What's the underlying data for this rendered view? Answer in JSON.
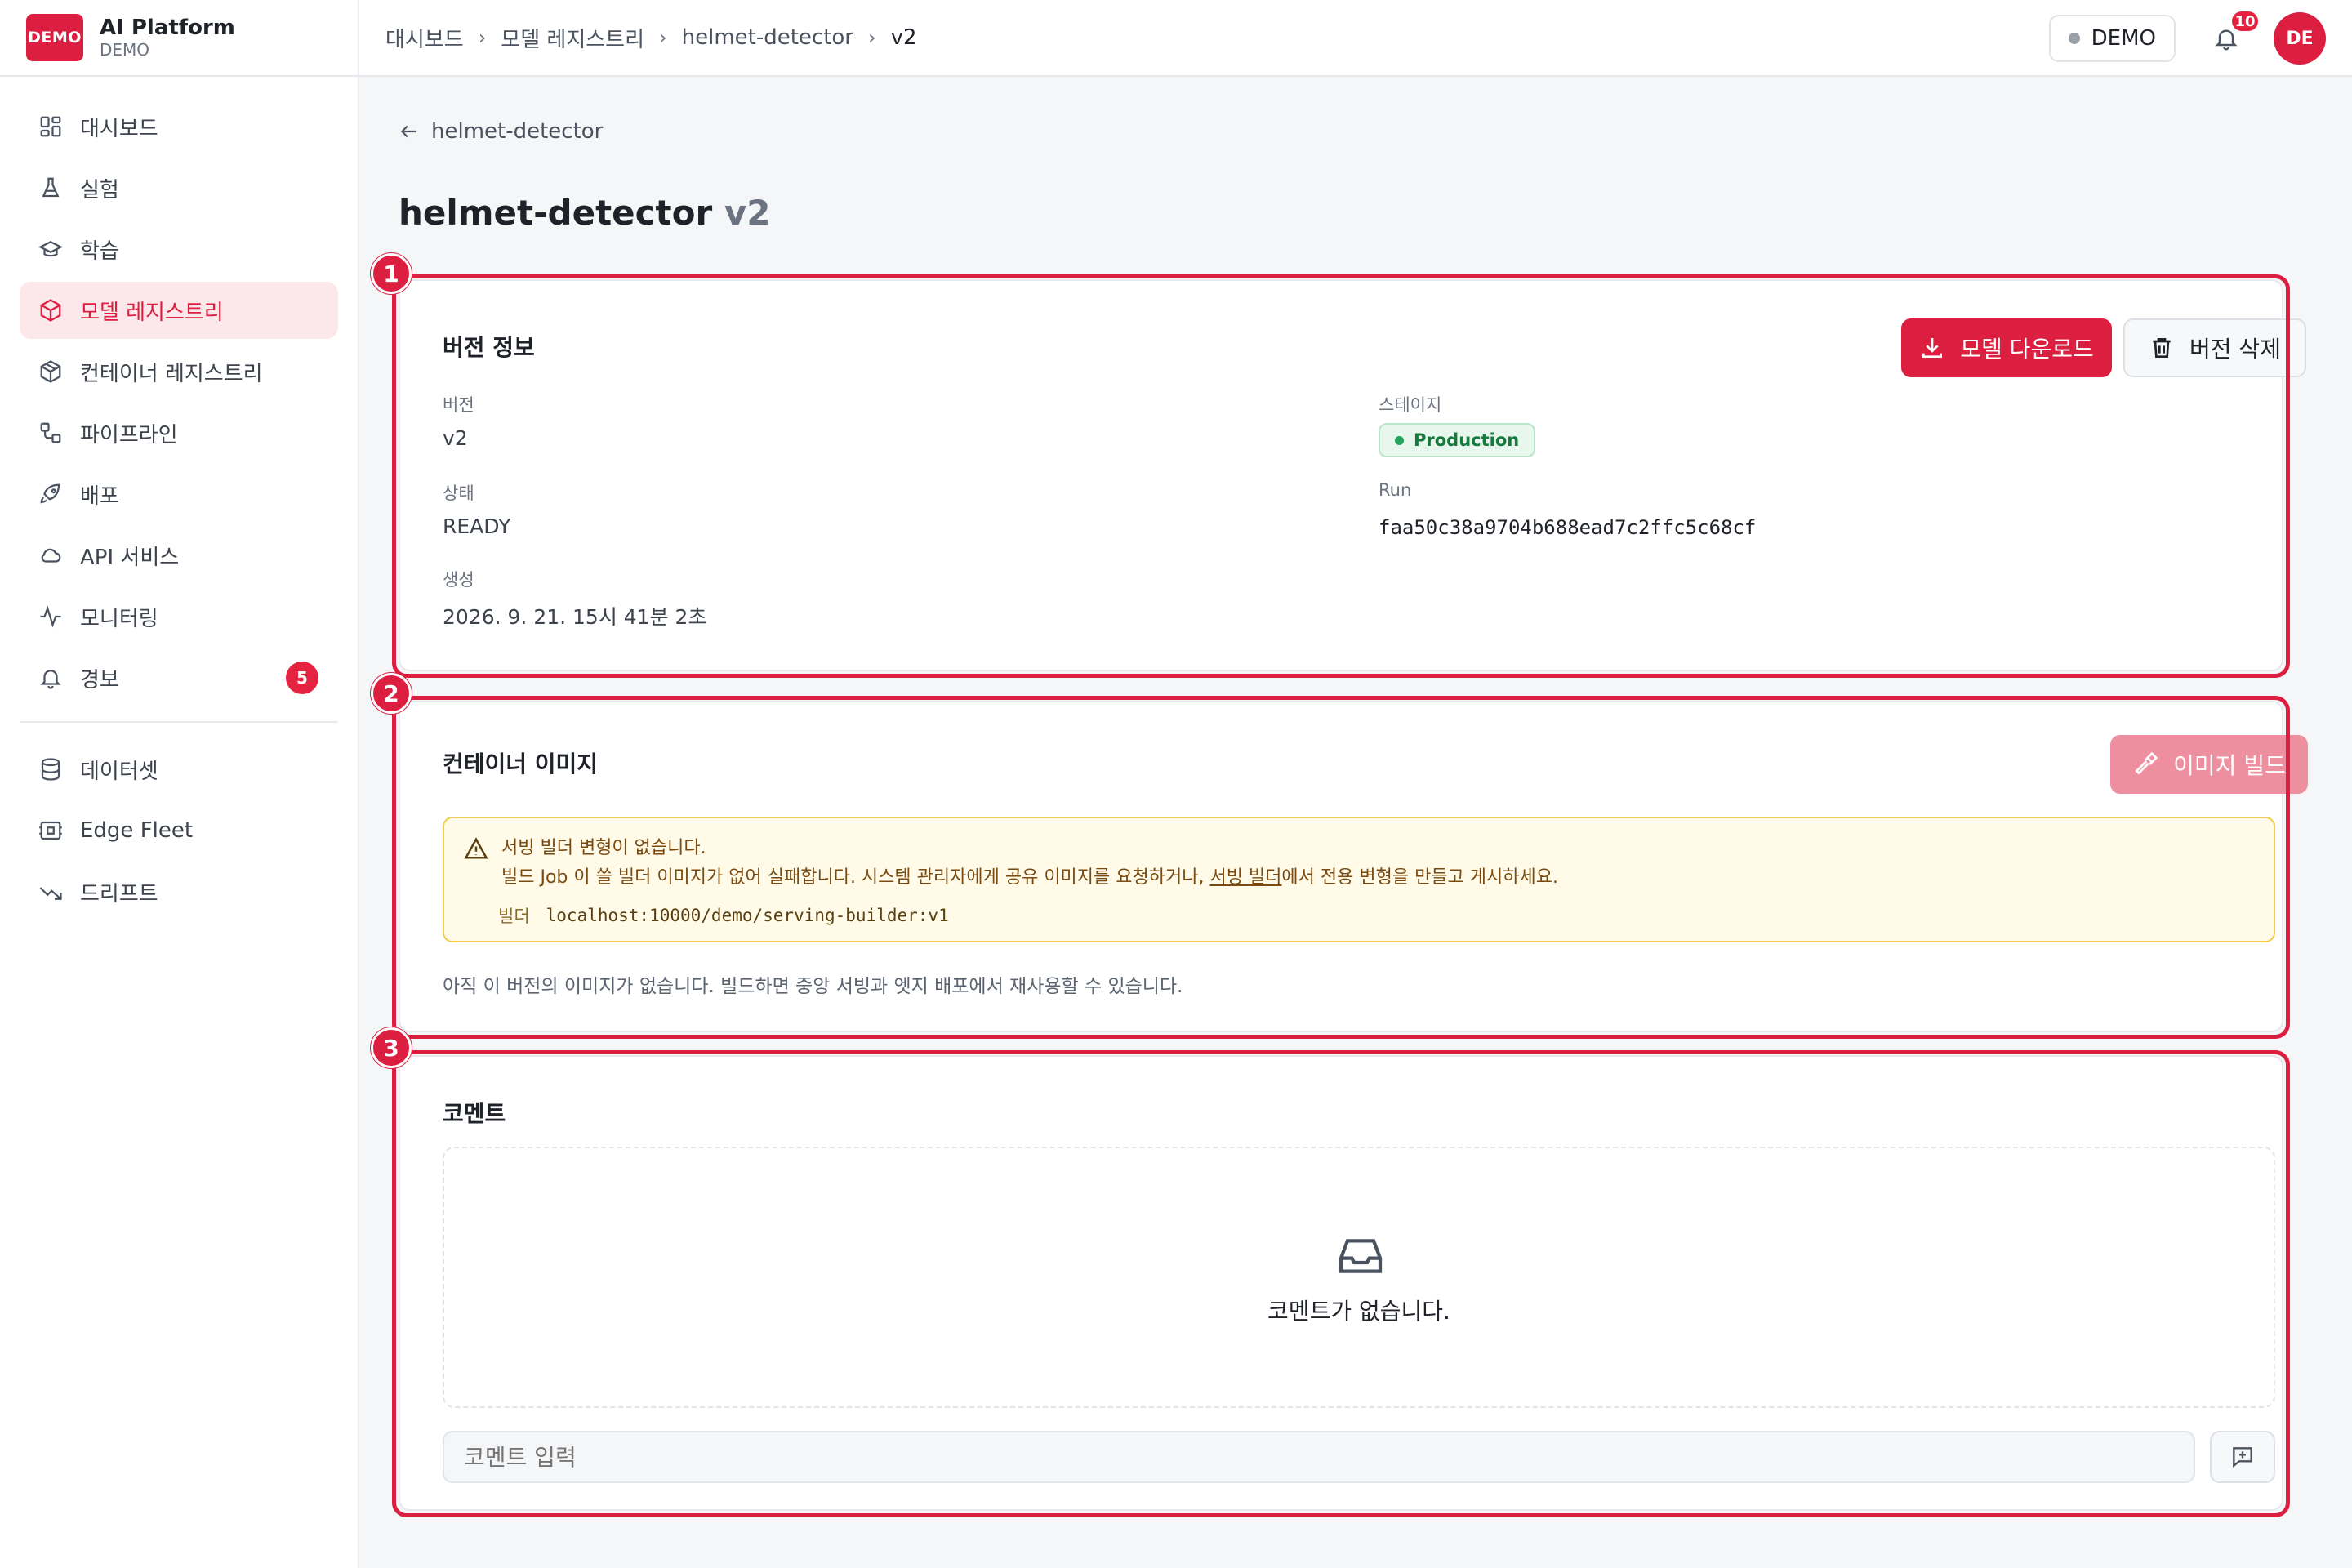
{
  "brand": {
    "logo_text": "DEMO",
    "name": "AI Platform",
    "sub": "DEMO"
  },
  "sidebar": {
    "items": [
      {
        "label": "대시보드",
        "icon": "dashboard-icon"
      },
      {
        "label": "실험",
        "icon": "flask-icon"
      },
      {
        "label": "학습",
        "icon": "graduation-cap-icon"
      },
      {
        "label": "모델 레지스트리",
        "icon": "box-icon",
        "active": true
      },
      {
        "label": "컨테이너 레지스트리",
        "icon": "package-icon"
      },
      {
        "label": "파이프라인",
        "icon": "workflow-icon"
      },
      {
        "label": "배포",
        "icon": "rocket-icon"
      },
      {
        "label": "API 서비스",
        "icon": "cloud-icon"
      },
      {
        "label": "모니터링",
        "icon": "activity-icon"
      },
      {
        "label": "경보",
        "icon": "bell-icon",
        "badge": "5"
      }
    ],
    "secondary_items": [
      {
        "label": "데이터셋",
        "icon": "database-icon"
      },
      {
        "label": "Edge Fleet",
        "icon": "cpu-icon"
      },
      {
        "label": "드리프트",
        "icon": "trending-down-icon"
      }
    ]
  },
  "breadcrumb": [
    "대시보드",
    "모델 레지스트리",
    "helmet-detector",
    "v2"
  ],
  "topbar": {
    "env": "DEMO",
    "notifications": "10",
    "avatar": "DE"
  },
  "page": {
    "back_label": "helmet-detector",
    "title": "helmet-detector",
    "title_version": "v2"
  },
  "version_info": {
    "marker": "1",
    "title": "버전 정보",
    "download_label": "모델 다운로드",
    "delete_label": "버전 삭제",
    "version_label": "버전",
    "version_value": "v2",
    "stage_label": "스테이지",
    "stage_value": "Production",
    "status_label": "상태",
    "status_value": "READY",
    "run_label": "Run",
    "run_value": "faa50c38a9704b688ead7c2ffc5c68cf",
    "created_label": "생성",
    "created_value": "2026. 9. 21. 15시 41분 2초"
  },
  "container_image": {
    "marker": "2",
    "title": "컨테이너 이미지",
    "build_label": "이미지 빌드",
    "warning_title": "서빙 빌더 변형이 없습니다.",
    "warning_body_pre": "빌드 Job 이 쓸 빌더 이미지가 없어 실패합니다. 시스템 관리자에게 공유 이미지를 요청하거나, ",
    "warning_link": "서빙 빌더",
    "warning_body_post": "에서 전용 변형을 만들고 게시하세요.",
    "builder_label": "빌더",
    "builder_value": "localhost:10000/demo/serving-builder:v1",
    "empty_note": "아직 이 버전의 이미지가 없습니다. 빌드하면 중앙 서빙과 엣지 배포에서 재사용할 수 있습니다."
  },
  "comments": {
    "marker": "3",
    "title": "코멘트",
    "empty_text": "코멘트가 없습니다.",
    "input_placeholder": "코멘트 입력"
  },
  "colors": {
    "accent": "#dc1f40",
    "success": "#22a559",
    "warning_bg": "#fffbe8"
  }
}
